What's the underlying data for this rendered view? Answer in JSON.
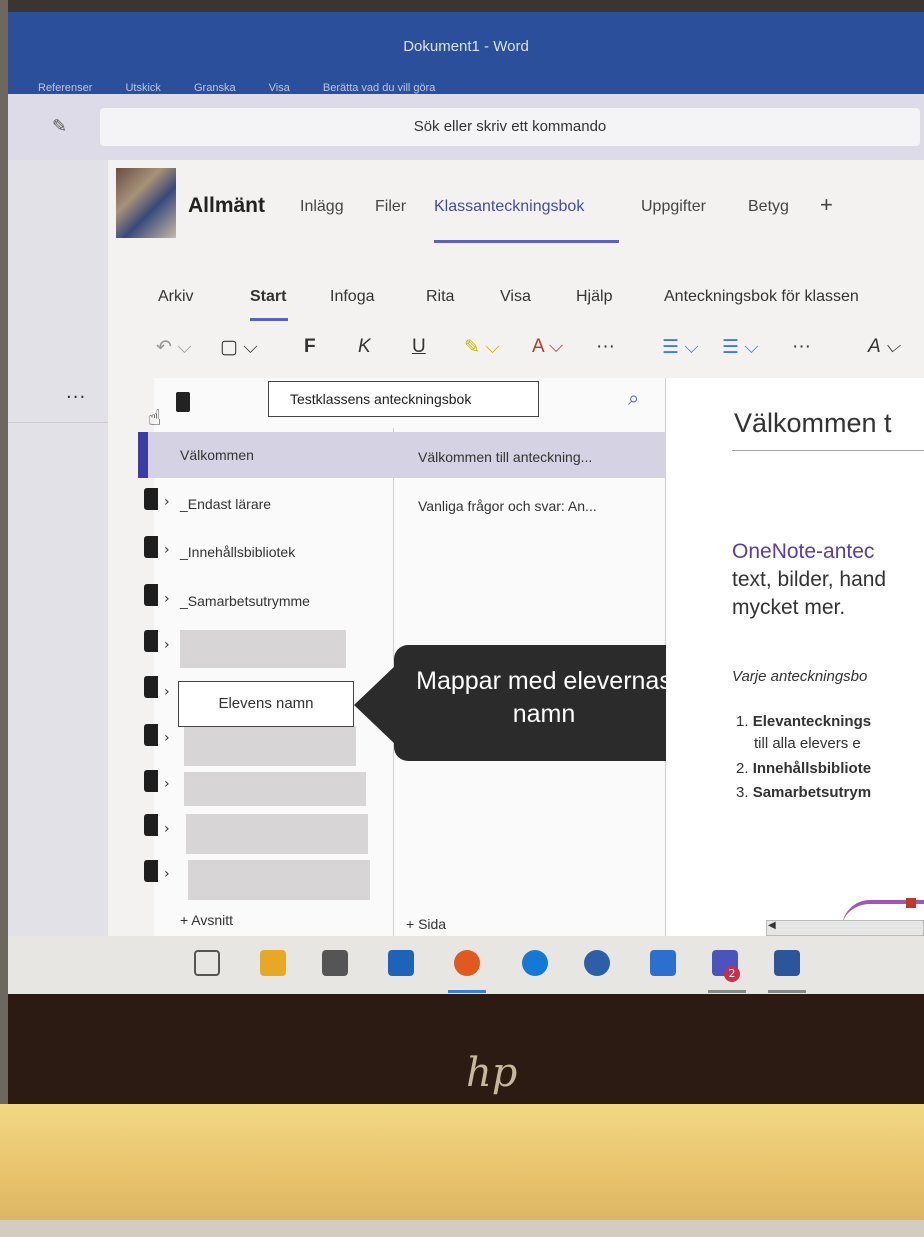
{
  "word": {
    "title": "Dokument1 - Word",
    "ribbon": [
      "Referenser",
      "Utskick",
      "Granska",
      "Visa",
      "Berätta vad du vill göra"
    ]
  },
  "teams": {
    "command_placeholder": "Sök eller skriv ett kommando",
    "rail_more": "...",
    "channel_name": "Allmänt",
    "tabs": [
      {
        "label": "Inlägg"
      },
      {
        "label": "Filer"
      },
      {
        "label": "Klassanteckningsbok"
      },
      {
        "label": "Uppgifter"
      },
      {
        "label": "Betyg"
      },
      {
        "label": "+"
      }
    ],
    "active_tab_color": "#5b5fc7"
  },
  "onenote": {
    "menus": [
      "Arkiv",
      "Start",
      "Infoga",
      "Rita",
      "Visa",
      "Hjälp",
      "Anteckningsbok för klassen"
    ],
    "tools": {
      "undo": "↶ ⌵",
      "clipboard": "▢ ⌵",
      "bold": "F",
      "italic": "K",
      "underline": "U",
      "highlight": "✎ ⌵",
      "font_color": "A ⌵",
      "more1": "···",
      "bullets": "☰ ⌵",
      "numbering": "☰ ⌵",
      "more2": "···",
      "styles": "A ⌵"
    },
    "notebook_title": "Testklassens anteckningsbok",
    "sections": [
      {
        "label": "Välkommen"
      },
      {
        "label": "_Endast lärare"
      },
      {
        "label": "_Innehållsbibliotek"
      },
      {
        "label": "_Samarbetsutrymme"
      }
    ],
    "pages": [
      {
        "label": "Välkommen till anteckning..."
      },
      {
        "label": "Vanliga frågor och svar: An..."
      }
    ],
    "student_label": "Elevens namn",
    "callout": "Mappar med elevernas namn",
    "add_section": "+ Avsnitt",
    "add_page": "+ Sida",
    "content": {
      "title": "Välkommen t",
      "lead_purple": "OneNote-antec",
      "lead_line2": "text, bilder, hand",
      "lead_line3": "mycket mer.",
      "italic": "Varje anteckningsbo",
      "list": [
        {
          "num": "1.",
          "bold": "Elevantecknings",
          "sub": "till alla elevers e"
        },
        {
          "num": "2.",
          "bold": "Innehållsbibliote",
          "sub": ""
        },
        {
          "num": "3.",
          "bold": "Samarbetsutrym",
          "sub": ""
        }
      ]
    },
    "selected_color": "#d4d2e3",
    "accent": "#3b3ca6"
  },
  "taskbar": {
    "teams_badge": "2",
    "icons": [
      "task-view-icon",
      "file-explorer-icon",
      "store-icon",
      "mail-icon",
      "firefox-icon",
      "edge-icon",
      "calculator-icon",
      "folder-icon",
      "teams-icon",
      "word-icon"
    ]
  },
  "laptop": {
    "logo": "hp"
  }
}
